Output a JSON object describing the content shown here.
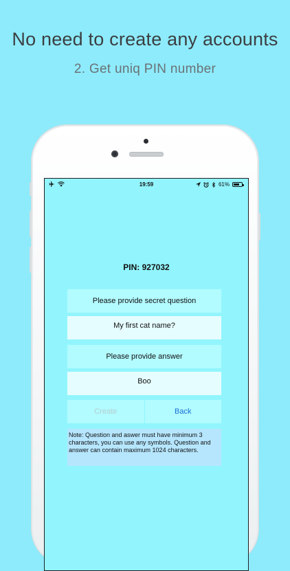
{
  "promo": {
    "headline": "No need to create any accounts",
    "subheadline": "2. Get uniq PIN number"
  },
  "status_bar": {
    "time": "19:59",
    "battery": "61%",
    "left_icons": [
      "airplane-icon",
      "wifi-icon"
    ],
    "right_icons": [
      "location-icon",
      "alarm-icon",
      "bluetooth-icon",
      "battery-icon"
    ]
  },
  "screen": {
    "pin_text": "PIN: 927032",
    "question_label": "Please provide secret question",
    "question_value": "My first cat name?",
    "answer_label": "Please provide answer",
    "answer_value": "Boo",
    "create_label": "Create",
    "back_label": "Back",
    "note": "Note: Question and aswer must have minimum 3 characters, you can use any symbols. Question and answer can contain maximum 1024 characters."
  },
  "colors": {
    "background": "#8eebfb",
    "screen": "#92f5fd",
    "field_label_bg": "#b2fbff",
    "field_input_bg": "#e6fdff",
    "note_bg": "#b6e6fe",
    "link_blue": "#1a6fd6"
  }
}
